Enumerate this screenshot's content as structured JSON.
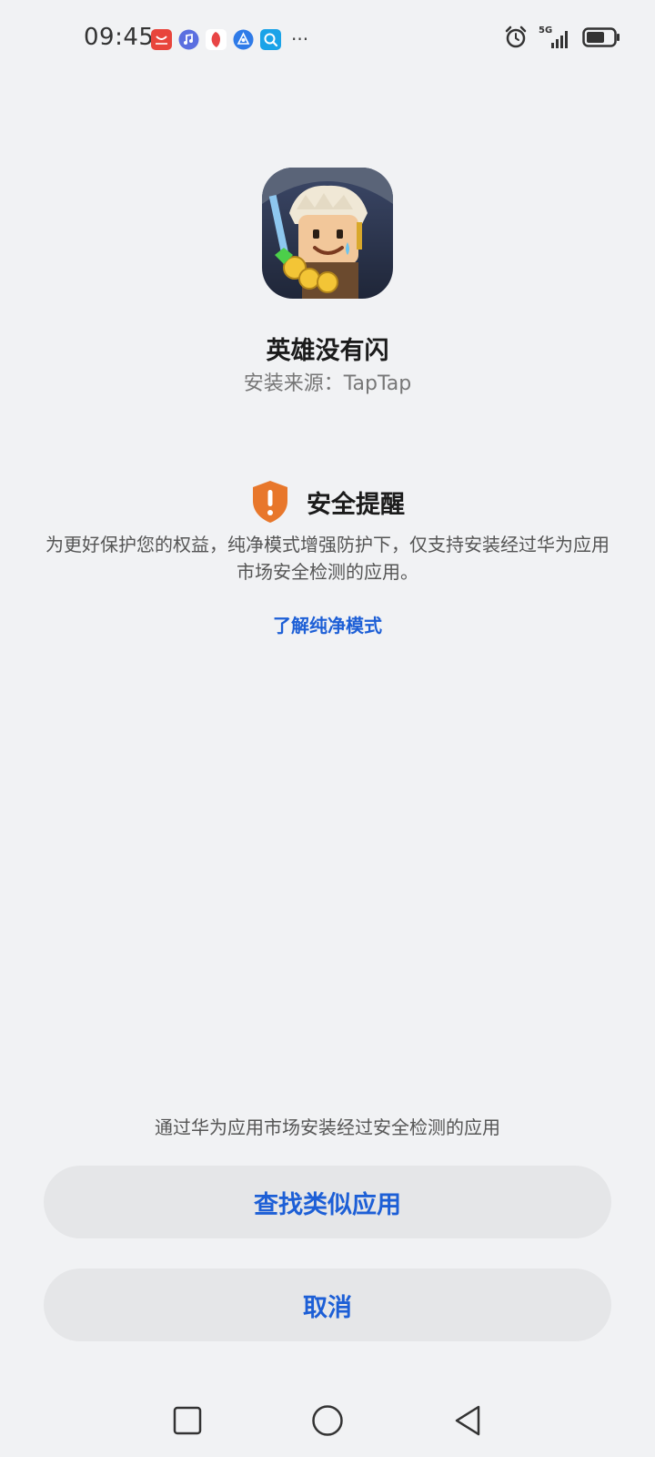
{
  "status_bar": {
    "time": "09:45",
    "more": "···",
    "network": "5G",
    "notification_icons": [
      "huawei-appgallery-icon",
      "music-icon",
      "petal-icon",
      "browser-icon",
      "search-app-icon"
    ],
    "status_icons": [
      "alarm-icon",
      "signal-icon",
      "battery-icon"
    ],
    "battery_level": 0.6
  },
  "app": {
    "name": "英雄没有闪",
    "install_source": "安装来源：TapTap"
  },
  "security": {
    "title": "安全提醒",
    "message": "为更好保护您的权益，纯净模式增强防护下，仅支持安装经过华为应用市场安全检测的应用。",
    "learn_more": "了解纯净模式"
  },
  "actions": {
    "hint": "通过华为应用市场安装经过安全检测的应用",
    "find_similar": "查找类似应用",
    "cancel": "取消"
  },
  "colors": {
    "background": "#f1f2f4",
    "accent_blue": "#1d5fd6",
    "shield_orange": "#e8772b",
    "button_bg": "#e5e6e8"
  }
}
